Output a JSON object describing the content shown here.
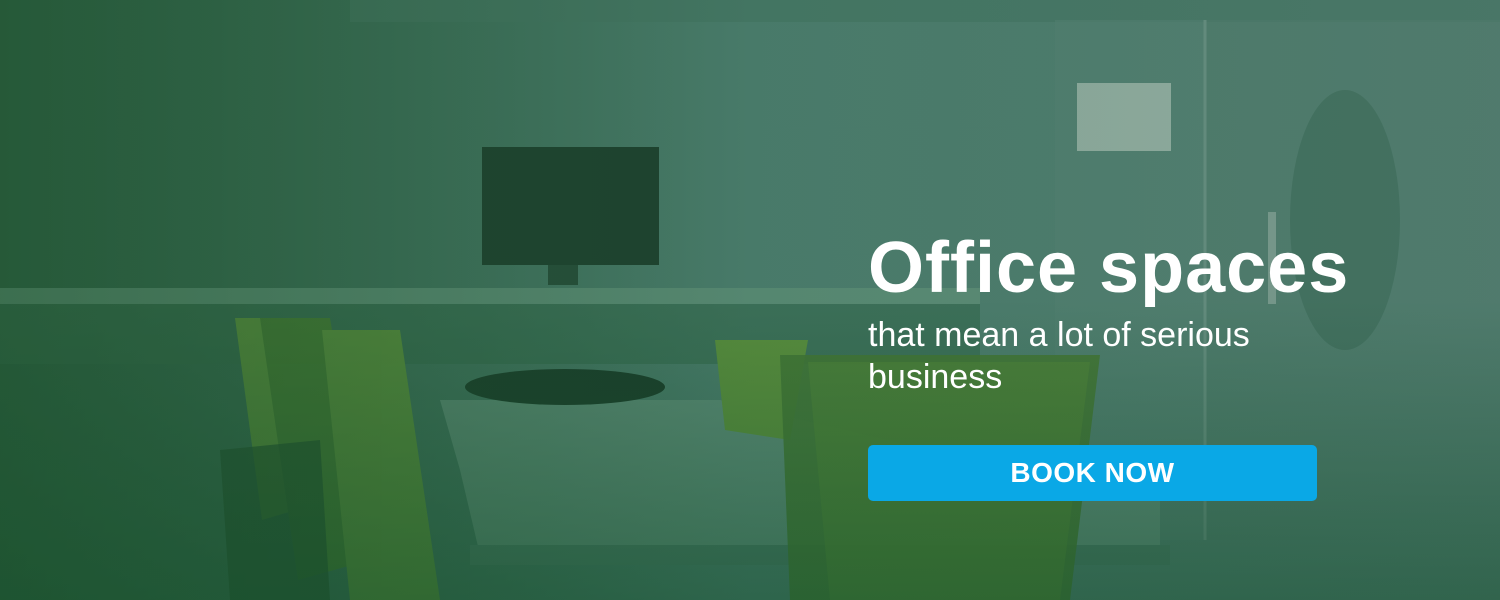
{
  "hero": {
    "headline": "Office spaces",
    "subheadline": "that mean a lot of serious business",
    "cta_label": "BOOK NOW"
  },
  "colors": {
    "overlay": "#2f6a48",
    "button": "#0aa8e6",
    "text": "#ffffff"
  }
}
